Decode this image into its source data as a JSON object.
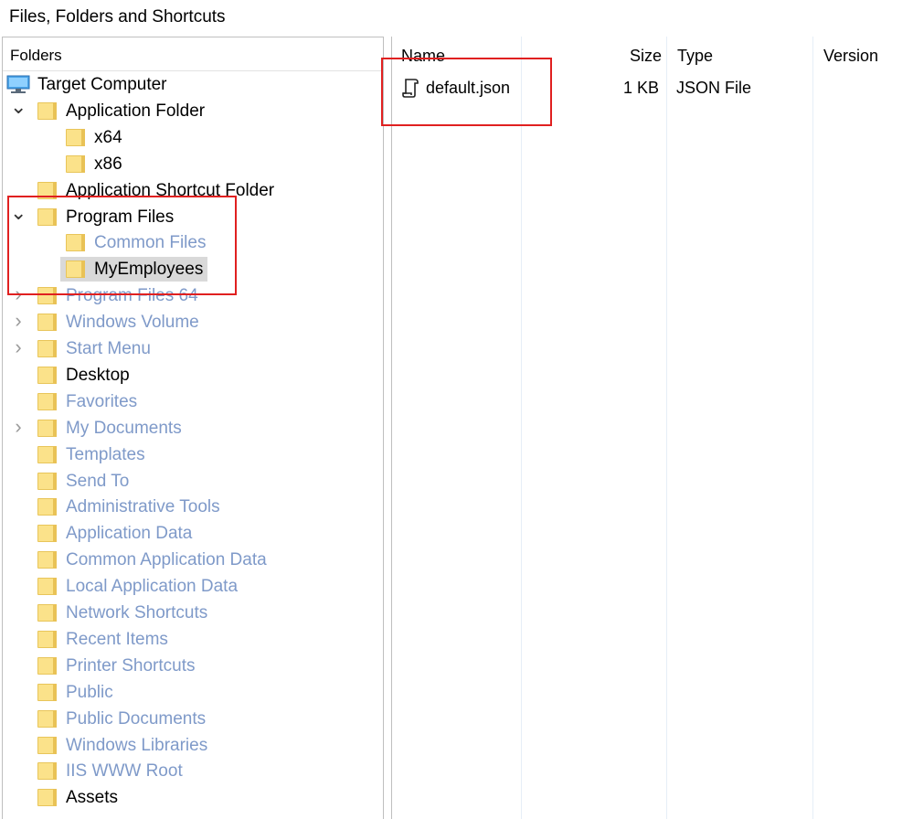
{
  "window": {
    "title": "Files, Folders and Shortcuts"
  },
  "folders_panel": {
    "header": "Folders",
    "tree": [
      {
        "label": "Target Computer",
        "icon": "computer-icon",
        "toggle": "none",
        "dim": false
      },
      {
        "label": "Application Folder",
        "icon": "folder-icon",
        "toggle": "expanded",
        "dim": false
      },
      {
        "label": "x64",
        "icon": "folder-icon",
        "toggle": "none",
        "dim": false
      },
      {
        "label": "x86",
        "icon": "folder-icon",
        "toggle": "none",
        "dim": false
      },
      {
        "label": "Application Shortcut Folder",
        "icon": "folder-icon",
        "toggle": "none",
        "dim": false
      },
      {
        "label": "Program Files",
        "icon": "folder-icon",
        "toggle": "expanded",
        "dim": false
      },
      {
        "label": "Common Files",
        "icon": "folder-icon",
        "toggle": "none",
        "dim": true
      },
      {
        "label": "MyEmployees",
        "icon": "folder-icon",
        "toggle": "none",
        "dim": false,
        "selected": true
      },
      {
        "label": "Program Files 64",
        "icon": "folder-icon",
        "toggle": "collapsed",
        "dim": true
      },
      {
        "label": "Windows Volume",
        "icon": "folder-icon",
        "toggle": "collapsed",
        "dim": true
      },
      {
        "label": "Start Menu",
        "icon": "folder-icon",
        "toggle": "collapsed",
        "dim": true
      },
      {
        "label": "Desktop",
        "icon": "folder-icon",
        "toggle": "none",
        "dim": false
      },
      {
        "label": "Favorites",
        "icon": "folder-icon",
        "toggle": "none",
        "dim": true
      },
      {
        "label": "My Documents",
        "icon": "folder-icon",
        "toggle": "collapsed",
        "dim": true
      },
      {
        "label": "Templates",
        "icon": "folder-icon",
        "toggle": "none",
        "dim": true
      },
      {
        "label": "Send To",
        "icon": "folder-icon",
        "toggle": "none",
        "dim": true
      },
      {
        "label": "Administrative Tools",
        "icon": "folder-icon",
        "toggle": "none",
        "dim": true
      },
      {
        "label": "Application Data",
        "icon": "folder-icon",
        "toggle": "none",
        "dim": true
      },
      {
        "label": "Common Application Data",
        "icon": "folder-icon",
        "toggle": "none",
        "dim": true
      },
      {
        "label": "Local Application Data",
        "icon": "folder-icon",
        "toggle": "none",
        "dim": true
      },
      {
        "label": "Network Shortcuts",
        "icon": "folder-icon",
        "toggle": "none",
        "dim": true
      },
      {
        "label": "Recent Items",
        "icon": "folder-icon",
        "toggle": "none",
        "dim": true
      },
      {
        "label": "Printer Shortcuts",
        "icon": "folder-icon",
        "toggle": "none",
        "dim": true
      },
      {
        "label": "Public",
        "icon": "folder-icon",
        "toggle": "none",
        "dim": true
      },
      {
        "label": "Public Documents",
        "icon": "folder-icon",
        "toggle": "none",
        "dim": true
      },
      {
        "label": "Windows Libraries",
        "icon": "folder-icon",
        "toggle": "none",
        "dim": true
      },
      {
        "label": "IIS WWW Root",
        "icon": "folder-icon",
        "toggle": "none",
        "dim": true
      },
      {
        "label": "Assets",
        "icon": "folder-icon",
        "toggle": "none",
        "dim": false
      }
    ]
  },
  "files_panel": {
    "columns": {
      "name": "Name",
      "size": "Size",
      "type": "Type",
      "version": "Version"
    },
    "files": [
      {
        "name": "default.json",
        "size": "1 KB",
        "type": "JSON File",
        "icon": "json-file-icon"
      }
    ]
  },
  "colors": {
    "dim_text": "#7f9ac9",
    "highlight": "#e02020",
    "folder": "#fbe28a",
    "selection": "#d9d9d9"
  }
}
